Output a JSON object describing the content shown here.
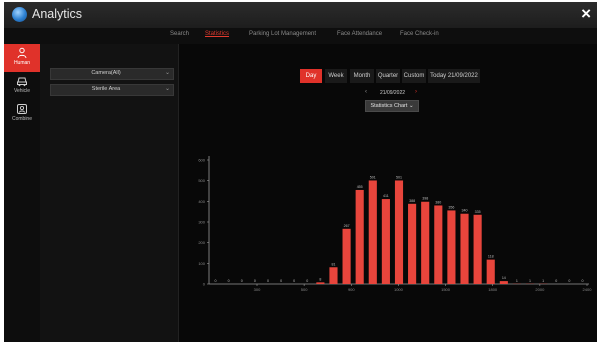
{
  "window": {
    "title": "Analytics",
    "close_symbol": "×"
  },
  "topnav": {
    "items": [
      {
        "label": "Search",
        "active": false
      },
      {
        "label": "Statistics",
        "active": true
      },
      {
        "label": "Parking Lot Management",
        "active": false
      },
      {
        "label": "Face Attendance",
        "active": false
      },
      {
        "label": "Face Check-in",
        "active": false
      }
    ]
  },
  "sidebar": {
    "items": [
      {
        "label": "Human",
        "icon": "human-icon",
        "active": true
      },
      {
        "label": "Vehicle",
        "icon": "vehicle-icon",
        "active": false
      },
      {
        "label": "Combine",
        "icon": "combine-icon",
        "active": false
      }
    ]
  },
  "filters": {
    "camera": {
      "value": "Camera(All)"
    },
    "area": {
      "value": "Sterile Area"
    },
    "caret": "⌄"
  },
  "tabs": [
    {
      "label": "Day",
      "active": true
    },
    {
      "label": "Week",
      "active": false
    },
    {
      "label": "Month",
      "active": false
    },
    {
      "label": "Quarter",
      "active": false
    },
    {
      "label": "Custom",
      "active": false
    },
    {
      "label": "Today 21/09/2022",
      "active": false
    }
  ],
  "date_nav": {
    "prev": "‹",
    "next": "›",
    "date": "21/09/2022"
  },
  "chart_select": {
    "value": "Statistics Chart",
    "caret": "⌄"
  },
  "colors": {
    "accent": "#e0322a",
    "bar": "#e8453c",
    "background": "#080808"
  },
  "chart_data": {
    "type": "bar",
    "title": "",
    "xlabel": "",
    "ylabel": "",
    "x_ticks": [
      "300",
      "500",
      "900",
      "1000",
      "1500",
      "1800",
      "2000",
      "2400"
    ],
    "y_ticks": [
      0,
      100,
      200,
      300,
      400,
      500,
      600
    ],
    "ylim": [
      0,
      600
    ],
    "values": [
      0,
      0,
      0,
      0,
      0,
      0,
      0,
      0,
      8,
      81,
      267,
      455,
      501,
      411,
      501,
      388,
      398,
      380,
      356,
      340,
      335,
      118,
      14,
      1,
      1,
      1,
      0,
      0,
      0
    ],
    "value_labels": [
      "0",
      "0",
      "0",
      "0",
      "0",
      "0",
      "0",
      "0",
      "8",
      "81",
      "267",
      "455",
      "501",
      "411",
      "501",
      "388",
      "398",
      "380",
      "356",
      "340",
      "335",
      "118",
      "14",
      "1",
      "1",
      "1",
      "0",
      "0",
      "0"
    ]
  }
}
